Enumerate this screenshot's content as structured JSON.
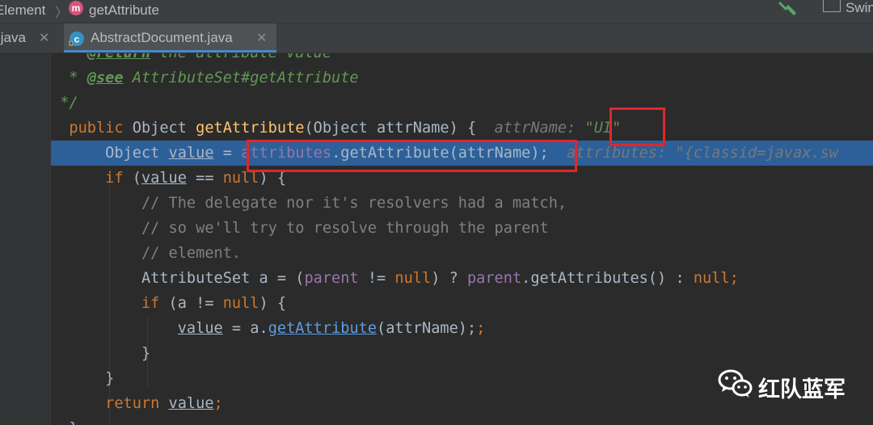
{
  "breadcrumb": {
    "items": [
      "Element",
      "getAttribute"
    ],
    "run_config": "Swin"
  },
  "tabs": [
    {
      "label": ".java",
      "active": false
    },
    {
      "label": "AbstractDocument.java",
      "active": true
    }
  ],
  "code": {
    "l0": {
      "tag": "@return",
      "text": " the attribute value"
    },
    "l1": {
      "tag": "@see",
      "text": " AttributeSet#getAttribute"
    },
    "l2": {
      "text": " */"
    },
    "l3": {
      "kw": "public",
      "t1": " Object ",
      "fn": "getAttribute",
      "t2": "(Object attrName) {",
      "hint_label": "attrName:",
      "hint_value": "\"UI\""
    },
    "l4": {
      "t1": "Object ",
      "var": "value",
      "t2": " = ",
      "fld": "attributes",
      "t3": ".getAttribute(attrName);",
      "hint": "attributes: \"{classid=javax.sw"
    },
    "l5": {
      "kw": "if",
      "t1": " (",
      "var": "value",
      "t2": " == ",
      "kw2": "null",
      "t3": ") {"
    },
    "l6": {
      "cmt": "// The delegate nor it's resolvers had a match,"
    },
    "l7": {
      "cmt": "// so we'll try to resolve through the parent"
    },
    "l8": {
      "cmt": "// element."
    },
    "l9": {
      "t1": "AttributeSet a = (",
      "fld": "parent",
      "t2": " != ",
      "kw": "null",
      "t3": ") ? ",
      "fld2": "parent",
      "t4": ".getAttributes() : ",
      "kw2": "null",
      "t5": ";"
    },
    "l10": {
      "kw": "if",
      "t1": " (a != ",
      "kw2": "null",
      "t2": ") {"
    },
    "l11": {
      "var": "value",
      "t1": " = a.",
      "call": "getAttribute",
      "t2": "(attrName);"
    },
    "l12": {
      "text": "}"
    },
    "l13": {
      "text": "}"
    },
    "l14": {
      "kw": "return",
      "t1": " ",
      "var": "value",
      "t2": ";"
    },
    "l15": {
      "text": "}"
    }
  },
  "watermark": {
    "text": "红队蓝军"
  },
  "colors": {
    "highlight": "#2d6099",
    "annotation_box": "#e0272c"
  }
}
